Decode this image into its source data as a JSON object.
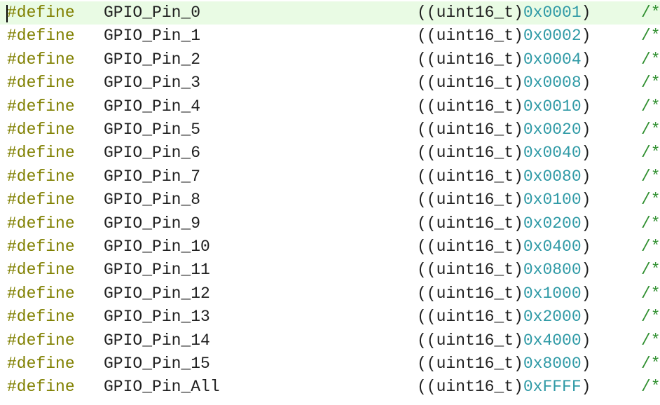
{
  "editor": {
    "lines": [
      {
        "directive": "#define",
        "name": "GPIO_Pin_0",
        "cast_type": "uint16_t",
        "value": "0x0001",
        "comment": "/*"
      },
      {
        "directive": "#define",
        "name": "GPIO_Pin_1",
        "cast_type": "uint16_t",
        "value": "0x0002",
        "comment": "/*"
      },
      {
        "directive": "#define",
        "name": "GPIO_Pin_2",
        "cast_type": "uint16_t",
        "value": "0x0004",
        "comment": "/*"
      },
      {
        "directive": "#define",
        "name": "GPIO_Pin_3",
        "cast_type": "uint16_t",
        "value": "0x0008",
        "comment": "/*"
      },
      {
        "directive": "#define",
        "name": "GPIO_Pin_4",
        "cast_type": "uint16_t",
        "value": "0x0010",
        "comment": "/*"
      },
      {
        "directive": "#define",
        "name": "GPIO_Pin_5",
        "cast_type": "uint16_t",
        "value": "0x0020",
        "comment": "/*"
      },
      {
        "directive": "#define",
        "name": "GPIO_Pin_6",
        "cast_type": "uint16_t",
        "value": "0x0040",
        "comment": "/*"
      },
      {
        "directive": "#define",
        "name": "GPIO_Pin_7",
        "cast_type": "uint16_t",
        "value": "0x0080",
        "comment": "/*"
      },
      {
        "directive": "#define",
        "name": "GPIO_Pin_8",
        "cast_type": "uint16_t",
        "value": "0x0100",
        "comment": "/*"
      },
      {
        "directive": "#define",
        "name": "GPIO_Pin_9",
        "cast_type": "uint16_t",
        "value": "0x0200",
        "comment": "/*"
      },
      {
        "directive": "#define",
        "name": "GPIO_Pin_10",
        "cast_type": "uint16_t",
        "value": "0x0400",
        "comment": "/*"
      },
      {
        "directive": "#define",
        "name": "GPIO_Pin_11",
        "cast_type": "uint16_t",
        "value": "0x0800",
        "comment": "/*"
      },
      {
        "directive": "#define",
        "name": "GPIO_Pin_12",
        "cast_type": "uint16_t",
        "value": "0x1000",
        "comment": "/*"
      },
      {
        "directive": "#define",
        "name": "GPIO_Pin_13",
        "cast_type": "uint16_t",
        "value": "0x2000",
        "comment": "/*"
      },
      {
        "directive": "#define",
        "name": "GPIO_Pin_14",
        "cast_type": "uint16_t",
        "value": "0x4000",
        "comment": "/*"
      },
      {
        "directive": "#define",
        "name": "GPIO_Pin_15",
        "cast_type": "uint16_t",
        "value": "0x8000",
        "comment": "/*"
      },
      {
        "directive": "#define",
        "name": "GPIO_Pin_All",
        "cast_type": "uint16_t",
        "value": "0xFFFF",
        "comment": "/*"
      }
    ]
  },
  "colors": {
    "background": "#ffffff",
    "current_line": "#e9fbe4",
    "preprocessor": "#808000",
    "identifier": "#1f1f1f",
    "number": "#2f9aa6",
    "comment": "#2f8f2f"
  }
}
